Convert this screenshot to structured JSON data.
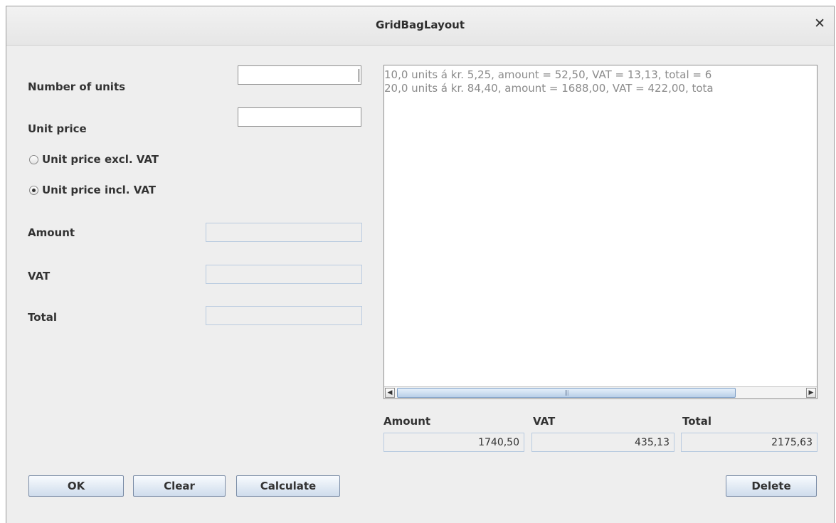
{
  "window": {
    "title": "GridBagLayout"
  },
  "form": {
    "units_label": "Number of units",
    "units_value": "",
    "price_label": "Unit price",
    "price_value": "",
    "radio_excl_label": "Unit price excl. VAT",
    "radio_incl_label": "Unit price incl. VAT",
    "selected_radio": "incl",
    "amount_label": "Amount",
    "amount_value": "",
    "vat_label": "VAT",
    "vat_value": "",
    "total_label": "Total",
    "total_value": ""
  },
  "list": {
    "items": [
      "10,0 units á kr. 5,25, amount = 52,50, VAT = 13,13, total = 6",
      "20,0 units á kr. 84,40, amount = 1688,00, VAT = 422,00, tota"
    ]
  },
  "summary": {
    "amount_label": "Amount",
    "amount_value": "1740,50",
    "vat_label": "VAT",
    "vat_value": "435,13",
    "total_label": "Total",
    "total_value": "2175,63"
  },
  "buttons": {
    "ok": "OK",
    "clear": "Clear",
    "calculate": "Calculate",
    "delete": "Delete"
  },
  "icons": {
    "close": "close-icon",
    "scroll_left": "arrow-left-icon",
    "scroll_right": "arrow-right-icon",
    "thumb_grip": "grip-icon"
  },
  "colors": {
    "window_bg": "#eeeeee",
    "button_gradient_bottom": "#cfdcec",
    "readonly_border": "#b9cbe0",
    "list_text": "#8b8b8b"
  }
}
